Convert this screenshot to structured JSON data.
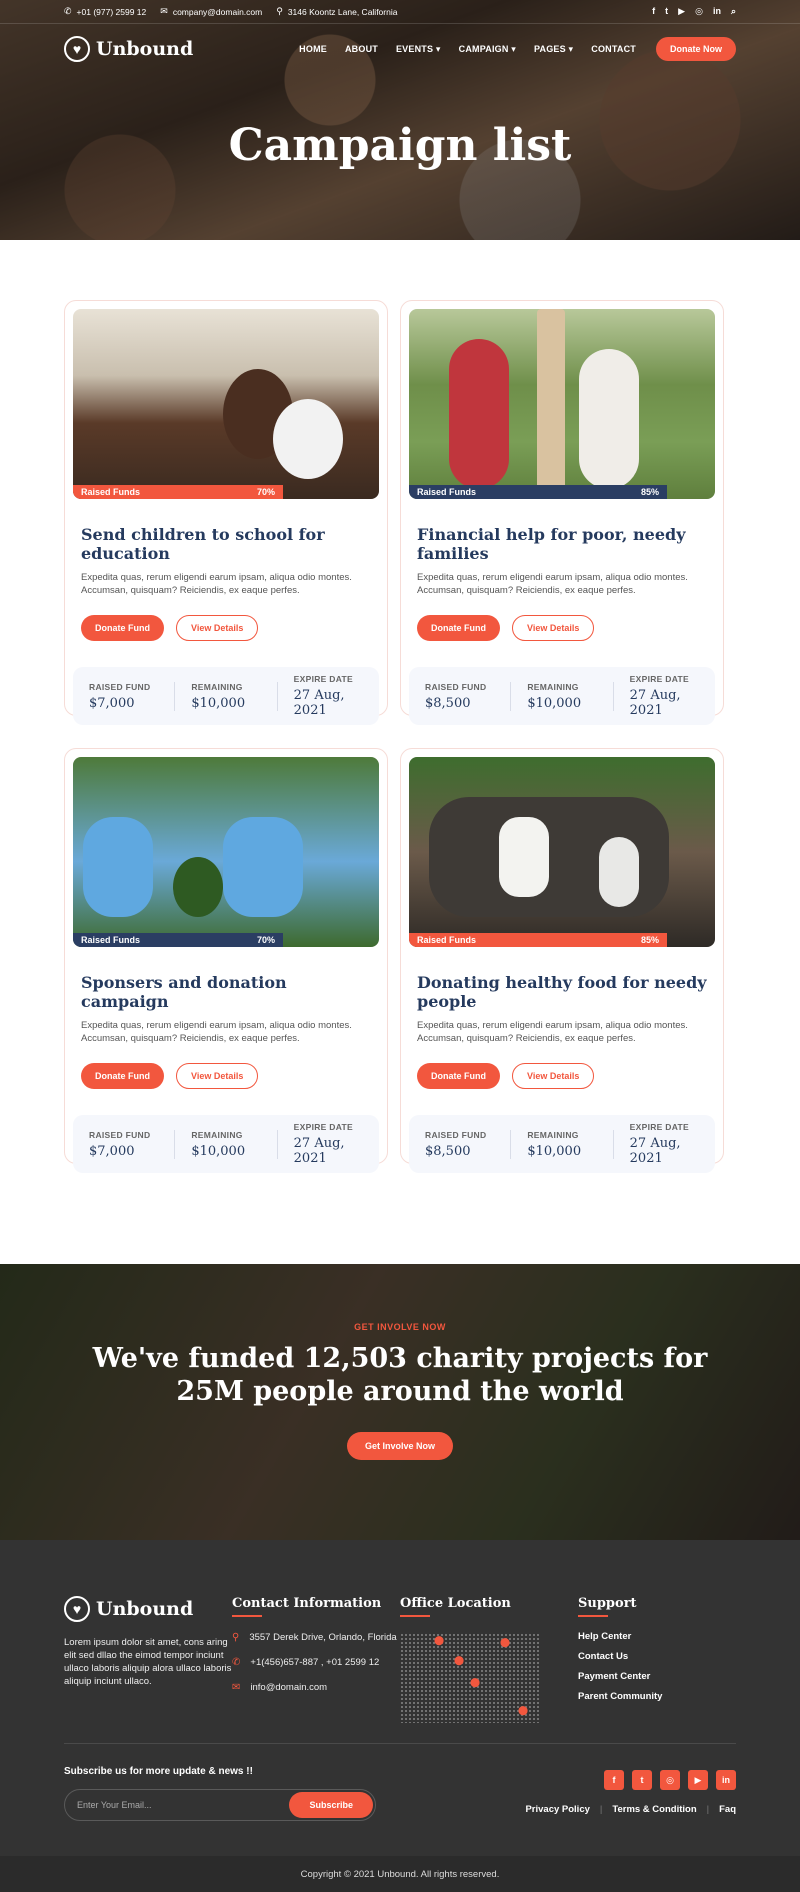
{
  "topbar": {
    "phone": "+01 (977) 2599 12",
    "email": "company@domain.com",
    "address": "3146 Koontz Lane, California",
    "social_icons": [
      "facebook-icon",
      "twitter-icon",
      "youtube-icon",
      "instagram-icon",
      "linkedin-icon",
      "search-icon"
    ]
  },
  "brand": {
    "name": "Unbound",
    "accent": "#f2573e",
    "navy": "#253a5e"
  },
  "nav": {
    "items": [
      "HOME",
      "ABOUT",
      "EVENTS",
      "CAMPAIGN",
      "PAGES",
      "CONTACT"
    ],
    "donate_label": "Donate Now"
  },
  "hero": {
    "title": "Campaign list"
  },
  "campaigns": [
    {
      "badge_label": "Raised Funds",
      "progress": "70%",
      "title": "Send children to school for education",
      "desc": "Expedita quas, rerum eligendi earum ipsam, aliqua odio montes. Accumsan, quisquam? Reiciendis, ex eaque perfes.",
      "donate": "Donate Fund",
      "details": "View Details",
      "raised_label": "RAISED FUND",
      "raised": "$7,000",
      "remaining_label": "REMAINING",
      "remaining": "$10,000",
      "expire_label": "EXPIRE DATE",
      "expire": "27 Aug, 2021"
    },
    {
      "badge_label": "Raised Funds",
      "progress": "85%",
      "title": "Financial help for poor, needy families",
      "desc": "Expedita quas, rerum eligendi earum ipsam, aliqua odio montes. Accumsan, quisquam? Reiciendis, ex eaque perfes.",
      "donate": "Donate Fund",
      "details": "View Details",
      "raised_label": "RAISED FUND",
      "raised": "$8,500",
      "remaining_label": "REMAINING",
      "remaining": "$10,000",
      "expire_label": "EXPIRE DATE",
      "expire": "27 Aug, 2021"
    },
    {
      "badge_label": "Raised Funds",
      "progress": "70%",
      "title": "Sponsers and donation campaign",
      "desc": "Expedita quas, rerum eligendi earum ipsam, aliqua odio montes. Accumsan, quisquam? Reiciendis, ex eaque perfes.",
      "donate": "Donate Fund",
      "details": "View Details",
      "raised_label": "RAISED FUND",
      "raised": "$7,000",
      "remaining_label": "REMAINING",
      "remaining": "$10,000",
      "expire_label": "EXPIRE DATE",
      "expire": "27 Aug, 2021"
    },
    {
      "badge_label": "Raised Funds",
      "progress": "85%",
      "title": "Donating healthy food for needy people",
      "desc": "Expedita quas, rerum eligendi earum ipsam, aliqua odio montes. Accumsan, quisquam? Reiciendis, ex eaque perfes.",
      "donate": "Donate Fund",
      "details": "View Details",
      "raised_label": "RAISED FUND",
      "raised": "$8,500",
      "remaining_label": "REMAINING",
      "remaining": "$10,000",
      "expire_label": "EXPIRE DATE",
      "expire": "27 Aug, 2021"
    }
  ],
  "involve": {
    "kicker": "GET INVOLVE NOW",
    "title": "We've funded 12,503 charity projects for 25M people around the world",
    "button": "Get Involve Now"
  },
  "footer": {
    "about": "Lorem ipsum dolor sit amet, cons aring elit sed dllao the eimod tempor inciunt ullaco laboris aliquip alora ullaco laboris aliquip inciunt ullaco.",
    "contact_title": "Contact Information",
    "address": "3557 Derek Drive, Orlando, Florida",
    "phones": "+1(456)657-887 , +01 2599 12",
    "email": "info@domain.com",
    "office_title": "Office Location",
    "support_title": "Support",
    "support_links": [
      "Help Center",
      "Contact Us",
      "Payment Center",
      "Parent Community"
    ],
    "subscribe_title": "Subscribe us for more update & news !!",
    "subscribe_placeholder": "Enter Your Email...",
    "subscribe_button": "Subscribe",
    "social_icons": [
      "facebook-icon",
      "twitter-icon",
      "instagram-icon",
      "youtube-icon",
      "linkedin-icon"
    ],
    "legal": [
      "Privacy Policy",
      "Terms & Condition",
      "Faq"
    ],
    "copyright": "Copyright © 2021 Unbound. All rights reserved."
  }
}
